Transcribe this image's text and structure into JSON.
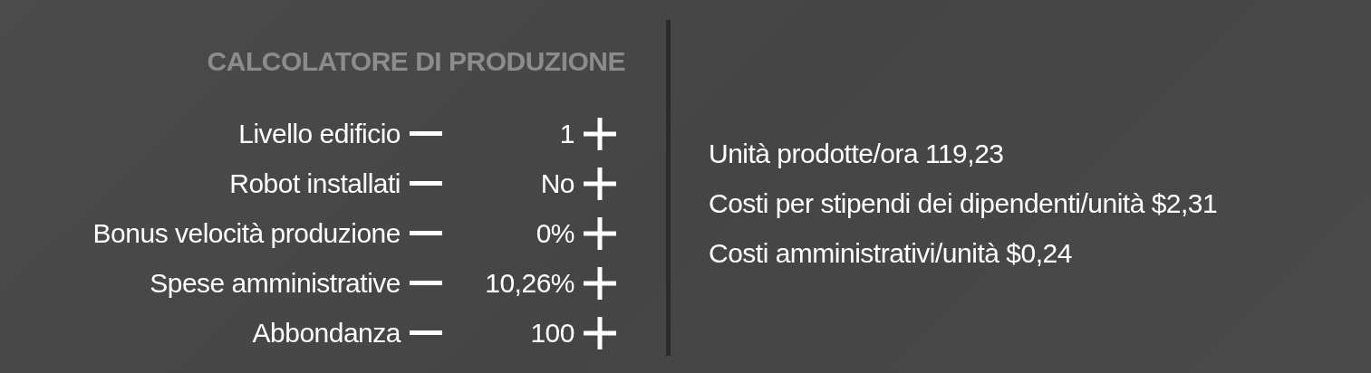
{
  "title": "CALCOLATORE DI PRODUZIONE",
  "inputs": [
    {
      "label": "Livello edificio",
      "value": "1"
    },
    {
      "label": "Robot installati",
      "value": "No"
    },
    {
      "label": "Bonus velocità produzione",
      "value": "0%"
    },
    {
      "label": "Spese amministrative",
      "value": "10,26%"
    },
    {
      "label": "Abbondanza",
      "value": "100"
    }
  ],
  "outputs": [
    "Unità prodotte/ora 119,23",
    "Costi per stipendi dei dipendenti/unità $2,31",
    "Costi amministrativi/unità $0,24"
  ]
}
